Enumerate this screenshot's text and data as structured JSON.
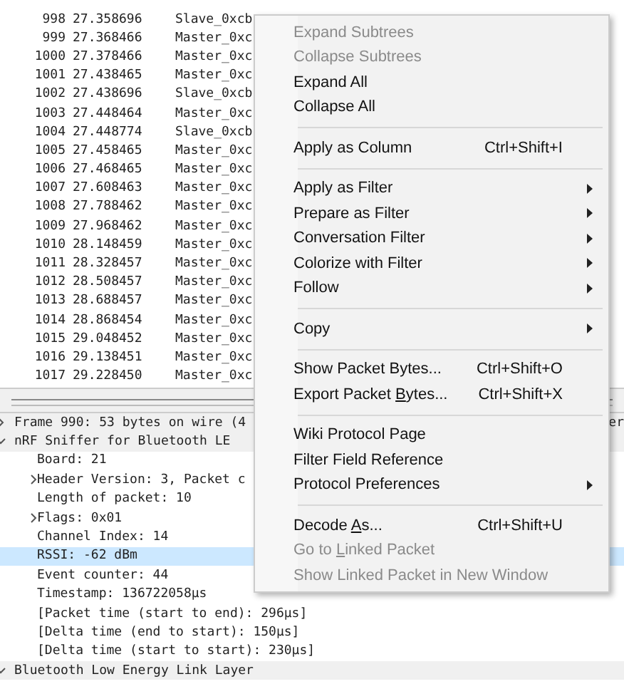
{
  "packet_list": {
    "rows": [
      {
        "no": "998",
        "time": "27.358696",
        "source": "Slave_0xcb"
      },
      {
        "no": "999",
        "time": "27.368466",
        "source": "Master_0xc"
      },
      {
        "no": "1000",
        "time": "27.378466",
        "source": "Master_0xc"
      },
      {
        "no": "1001",
        "time": "27.438465",
        "source": "Master_0xc"
      },
      {
        "no": "1002",
        "time": "27.438696",
        "source": "Slave_0xcb"
      },
      {
        "no": "1003",
        "time": "27.448464",
        "source": "Master_0xc"
      },
      {
        "no": "1004",
        "time": "27.448774",
        "source": "Slave_0xcb"
      },
      {
        "no": "1005",
        "time": "27.458465",
        "source": "Master_0xc"
      },
      {
        "no": "1006",
        "time": "27.468465",
        "source": "Master_0xc"
      },
      {
        "no": "1007",
        "time": "27.608463",
        "source": "Master_0xc"
      },
      {
        "no": "1008",
        "time": "27.788462",
        "source": "Master_0xc"
      },
      {
        "no": "1009",
        "time": "27.968462",
        "source": "Master_0xc"
      },
      {
        "no": "1010",
        "time": "28.148459",
        "source": "Master_0xc"
      },
      {
        "no": "1011",
        "time": "28.328457",
        "source": "Master_0xc"
      },
      {
        "no": "1012",
        "time": "28.508457",
        "source": "Master_0xc"
      },
      {
        "no": "1013",
        "time": "28.688457",
        "source": "Master_0xc"
      },
      {
        "no": "1014",
        "time": "28.868454",
        "source": "Master_0xc"
      },
      {
        "no": "1015",
        "time": "29.048452",
        "source": "Master_0xc"
      },
      {
        "no": "1016",
        "time": "29.138451",
        "source": "Master_0xc"
      },
      {
        "no": "1017",
        "time": "29.228450",
        "source": "Master_0xc"
      }
    ]
  },
  "packet_details": {
    "items": [
      {
        "text": "Frame 990: 53 bytes on wire (4",
        "tail": "er",
        "expanded": false,
        "section": true,
        "selected": false
      },
      {
        "text": "nRF Sniffer for Bluetooth LE",
        "expanded": true,
        "section": true,
        "selected": false,
        "children": [
          {
            "text": "Board: 21",
            "selected": false
          },
          {
            "text": "Header Version: 3, Packet c",
            "expanded": false,
            "selected": false
          },
          {
            "text": "Length of packet: 10",
            "selected": false
          },
          {
            "text": "Flags: 0x01",
            "expanded": false,
            "selected": false
          },
          {
            "text": "Channel Index: 14",
            "selected": false
          },
          {
            "text": "RSSI: -62 dBm",
            "selected": true
          },
          {
            "text": "Event counter: 44",
            "selected": false
          },
          {
            "text": "Timestamp: 136722058µs",
            "selected": false
          },
          {
            "text": "[Packet time (start to end): 296µs]",
            "selected": false
          },
          {
            "text": "[Delta time (end to start): 150µs]",
            "selected": false
          },
          {
            "text": "[Delta time (start to start): 230µs]",
            "selected": false
          }
        ]
      },
      {
        "text": "Bluetooth Low Energy Link Layer",
        "expanded": true,
        "section": true,
        "selected": false
      }
    ]
  },
  "context_menu": {
    "items": [
      {
        "kind": "item",
        "label": "Expand Subtrees",
        "disabled": true
      },
      {
        "kind": "item",
        "label": "Collapse Subtrees",
        "disabled": true
      },
      {
        "kind": "item",
        "label": "Expand All",
        "disabled": false
      },
      {
        "kind": "item",
        "label": "Collapse All",
        "disabled": false
      },
      {
        "kind": "separator"
      },
      {
        "kind": "item",
        "label": "Apply as Column",
        "shortcut": "Ctrl+Shift+I",
        "disabled": false
      },
      {
        "kind": "separator"
      },
      {
        "kind": "submenu",
        "label": "Apply as Filter",
        "disabled": false
      },
      {
        "kind": "submenu",
        "label": "Prepare as Filter",
        "disabled": false
      },
      {
        "kind": "submenu",
        "label": "Conversation Filter",
        "disabled": false
      },
      {
        "kind": "submenu",
        "label": "Colorize with Filter",
        "disabled": false
      },
      {
        "kind": "submenu",
        "label": "Follow",
        "disabled": false
      },
      {
        "kind": "separator"
      },
      {
        "kind": "submenu",
        "label": "Copy",
        "disabled": false
      },
      {
        "kind": "separator"
      },
      {
        "kind": "item",
        "label": "Show Packet Bytes...",
        "shortcut": "Ctrl+Shift+O",
        "disabled": false
      },
      {
        "kind": "item",
        "label": "Export Packet ",
        "mnemonic": "B",
        "label_rest": "ytes...",
        "shortcut": "Ctrl+Shift+X",
        "disabled": false
      },
      {
        "kind": "separator"
      },
      {
        "kind": "item",
        "label": "Wiki Protocol Page",
        "disabled": false
      },
      {
        "kind": "item",
        "label": "Filter Field Reference",
        "disabled": false
      },
      {
        "kind": "submenu",
        "label": "Protocol Preferences",
        "disabled": false
      },
      {
        "kind": "separator"
      },
      {
        "kind": "item",
        "label": "Decode ",
        "mnemonic": "A",
        "label_rest": "s...",
        "shortcut": "Ctrl+Shift+U",
        "disabled": false
      },
      {
        "kind": "item",
        "label": "Go to ",
        "mnemonic": "L",
        "label_rest": "inked Packet",
        "disabled": true
      },
      {
        "kind": "item",
        "label": "Show Linked Packet in New Window",
        "disabled": true
      }
    ]
  }
}
